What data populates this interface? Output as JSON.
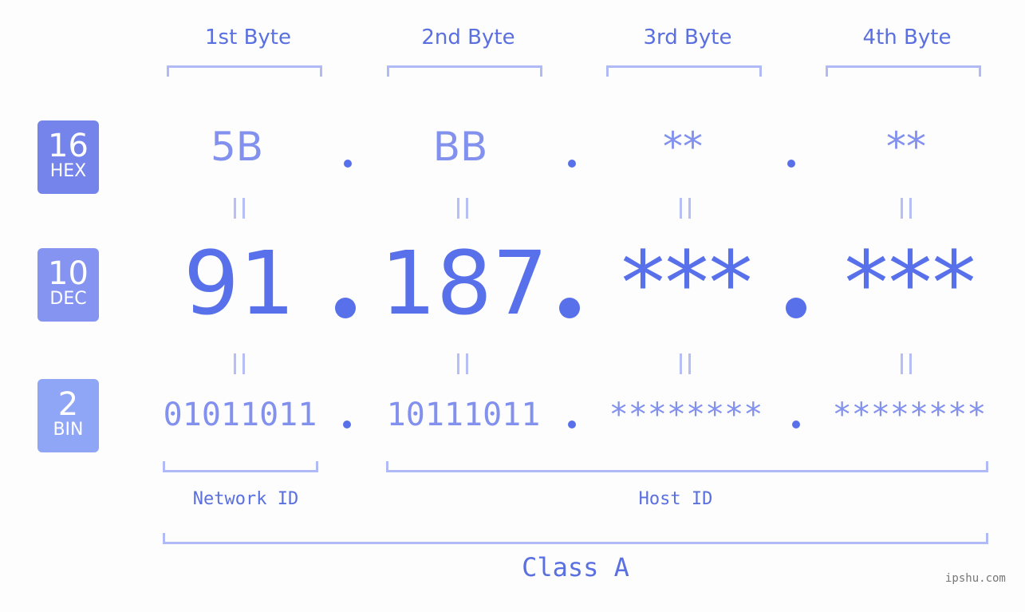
{
  "headers": [
    "1st Byte",
    "2nd Byte",
    "3rd Byte",
    "4th Byte"
  ],
  "badges": [
    {
      "base": "16",
      "label": "HEX",
      "color": "#7584ea"
    },
    {
      "base": "10",
      "label": "DEC",
      "color": "#8594f0"
    },
    {
      "base": "2",
      "label": "BIN",
      "color": "#8fa6f7"
    }
  ],
  "hex": [
    "5B",
    "BB",
    "**",
    "**"
  ],
  "dec": [
    "91",
    "187",
    "***",
    "***"
  ],
  "bin": [
    "01011011",
    "10111011",
    "********",
    "********"
  ],
  "separator": ".",
  "labels": {
    "network_id": "Network ID",
    "host_id": "Host ID",
    "class": "Class A"
  },
  "watermark": "ipshu.com",
  "colors": {
    "accent": "#5870ea",
    "light_accent": "#8290ee",
    "bracket": "#b0baf6",
    "background": "#fcfdfc"
  }
}
